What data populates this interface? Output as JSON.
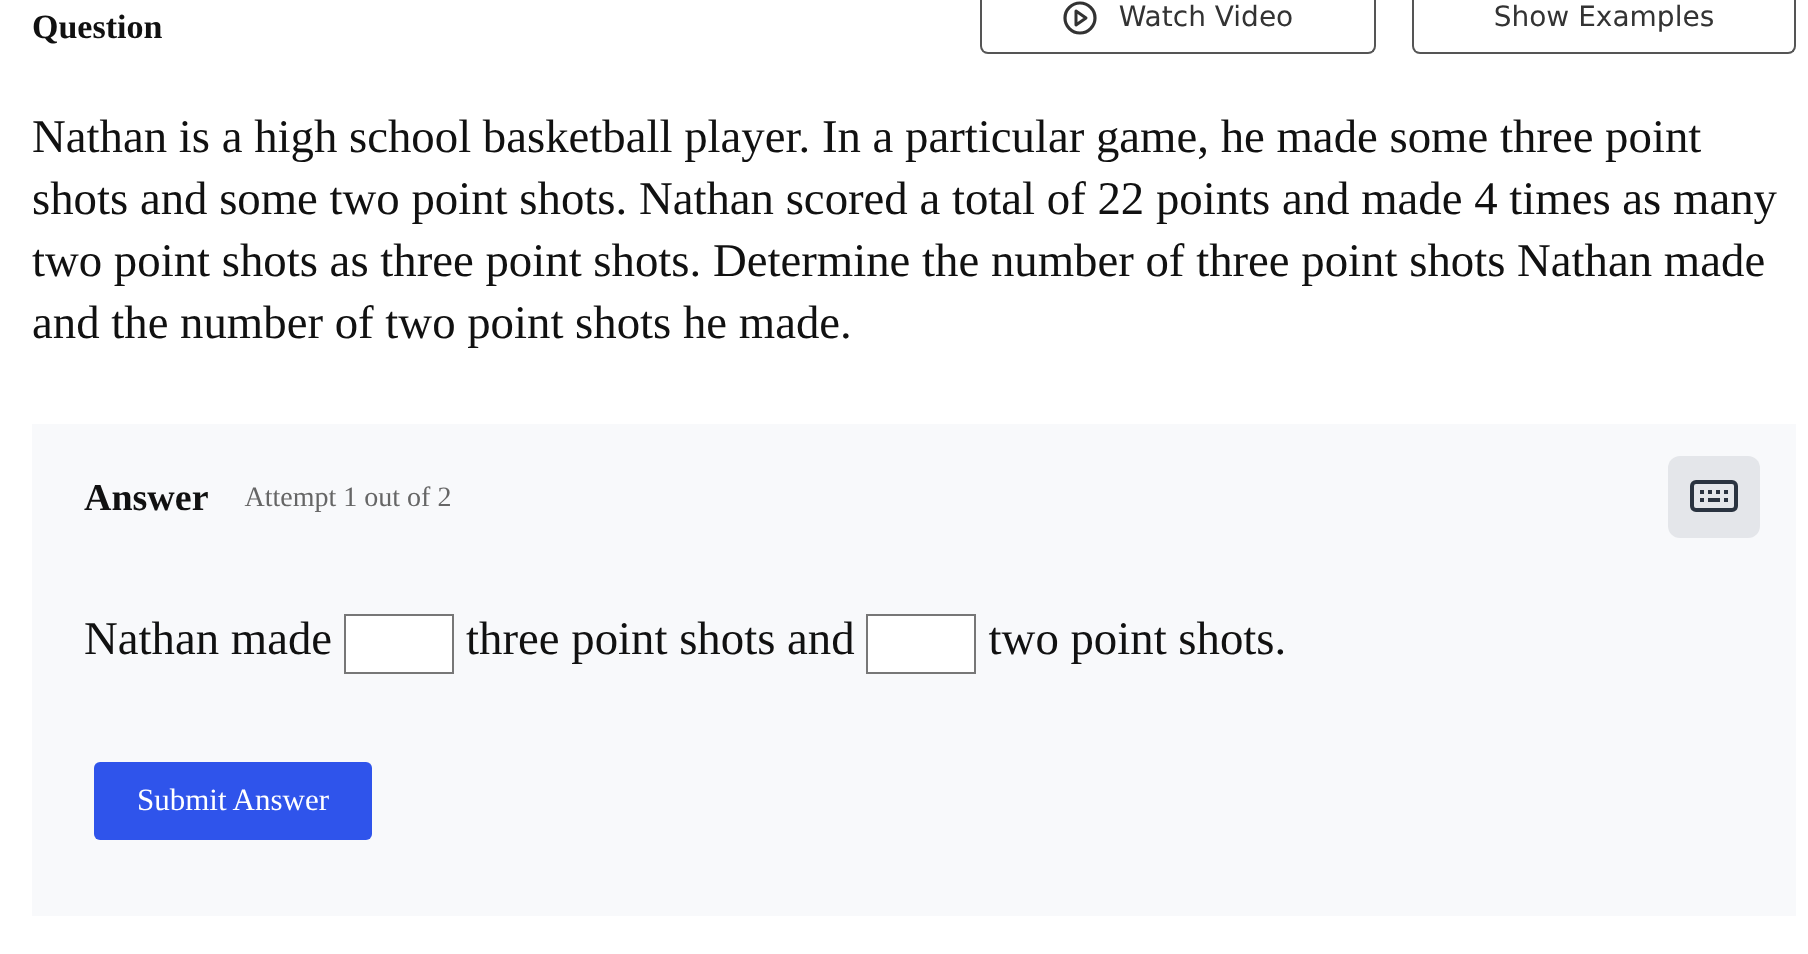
{
  "header": {
    "title": "Question",
    "buttons": [
      {
        "kind": "video",
        "label": "Watch Video"
      },
      {
        "kind": "plain",
        "label": "Show Examples"
      }
    ]
  },
  "question": {
    "text": "Nathan is a high school basketball player. In a particular game, he made some three point shots and some two point shots. Nathan scored a total of 22 points and made 4 times as many two point shots as three point shots. Determine the number of three point shots Nathan made and the number of two point shots he made."
  },
  "answer": {
    "title": "Answer",
    "attempt": "Attempt 1 out of 2",
    "sentence": [
      {
        "kind": "text",
        "text": "Nathan made"
      },
      {
        "kind": "blank"
      },
      {
        "kind": "text",
        "text": "three point shots and"
      },
      {
        "kind": "blank"
      },
      {
        "kind": "text",
        "text": "two point shots."
      }
    ],
    "submit": "Submit Answer"
  }
}
